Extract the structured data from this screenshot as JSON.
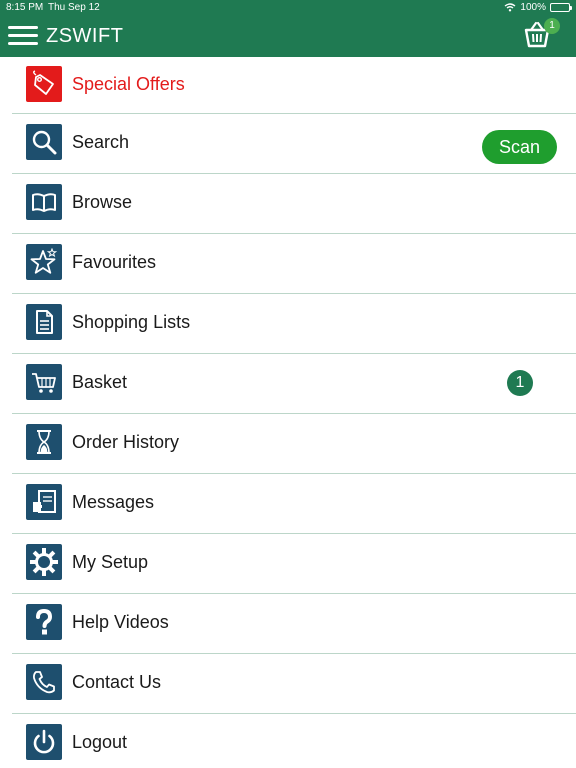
{
  "status_bar": {
    "time": "8:15 PM",
    "date": "Thu Sep 12",
    "battery": "100%"
  },
  "header": {
    "title": "ZSWIFT",
    "cart_badge": "1"
  },
  "menu": {
    "special_offers": "Special Offers",
    "search": "Search",
    "scan": "Scan",
    "browse": "Browse",
    "favourites": "Favourites",
    "shopping_lists": "Shopping Lists",
    "basket": "Basket",
    "basket_count": "1",
    "order_history": "Order History",
    "messages": "Messages",
    "my_setup": "My Setup",
    "help_videos": "Help Videos",
    "contact_us": "Contact Us",
    "logout": "Logout"
  },
  "colors": {
    "header_green": "#1f7a52",
    "icon_navy": "#1e4f6e",
    "offer_red": "#e31b1b",
    "scan_green": "#1f9e2e",
    "divider": "#bcd6c9"
  },
  "icons": {
    "special_offers": "tag-icon",
    "search": "magnifier-icon",
    "browse": "book-icon",
    "favourites": "star-icon",
    "shopping_lists": "document-icon",
    "basket": "cart-icon",
    "order_history": "hourglass-icon",
    "messages": "message-icon",
    "my_setup": "gear-icon",
    "help_videos": "question-icon",
    "contact_us": "phone-icon",
    "logout": "power-icon",
    "header_cart": "basket-icon",
    "menu": "hamburger-icon"
  }
}
